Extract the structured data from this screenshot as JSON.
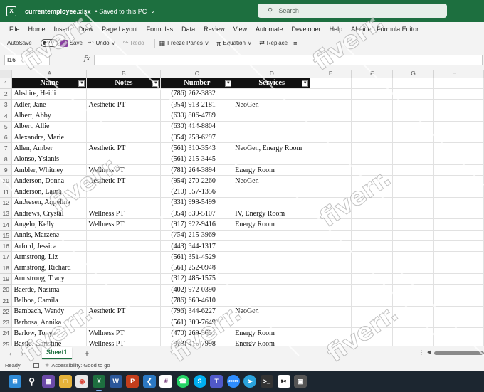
{
  "titlebar": {
    "filename": "currentemployee.xlsx",
    "saved_status": "• Saved to this PC",
    "search_placeholder": "Search",
    "accent_color": "#1d6f3f"
  },
  "menu": {
    "tabs": [
      "File",
      "Home",
      "Insert",
      "Draw",
      "Page Layout",
      "Formulas",
      "Data",
      "Review",
      "View",
      "Automate",
      "Developer",
      "Help",
      "AI-aided Formula Editor"
    ]
  },
  "toolbar": {
    "autosave_label": "AutoSave",
    "autosave_state": "Off",
    "save_label": "Save",
    "undo_label": "Undo",
    "redo_label": "Redo",
    "freeze_label": "Freeze Panes",
    "equation_label": "Equation",
    "replace_label": "Replace"
  },
  "formula_bar": {
    "name_box": "I16",
    "fx_label": "fx",
    "content": ""
  },
  "columns": [
    "A",
    "B",
    "C",
    "D",
    "E",
    "F",
    "G",
    "H"
  ],
  "header_row": {
    "row_number": "1",
    "cells": [
      "Name",
      "Notes",
      "Number",
      "Services"
    ]
  },
  "rows": [
    {
      "n": "2",
      "name": "Abshire, Heidi",
      "notes": "",
      "number": "(786) 262-3832",
      "services": ""
    },
    {
      "n": "3",
      "name": "Adler, Jane",
      "notes": "Aesthetic PT",
      "number": "(954) 913-2181",
      "services": "NeoGen"
    },
    {
      "n": "4",
      "name": "Albert, Abby",
      "notes": "",
      "number": "(630) 806-4789",
      "services": ""
    },
    {
      "n": "5",
      "name": "Albert, Allie",
      "notes": "",
      "number": "(630) 414-8804",
      "services": ""
    },
    {
      "n": "6",
      "name": "Alexandre, Marie",
      "notes": "",
      "number": "(954) 258-6297",
      "services": ""
    },
    {
      "n": "7",
      "name": "Allen, Amber",
      "notes": "Aesthetic PT",
      "number": "(561) 310-3543",
      "services": "NeoGen, Energy Room"
    },
    {
      "n": "8",
      "name": "Alonso, Yslanis",
      "notes": "",
      "number": "(561) 215-3445",
      "services": ""
    },
    {
      "n": "9",
      "name": "Ambler, Whitney",
      "notes": "Wellness PT",
      "number": "(781) 264-3894",
      "services": "Energy Room"
    },
    {
      "n": "10",
      "name": "Anderson, Donna",
      "notes": "Aesthetic PT",
      "number": "(954) 270-2260",
      "services": "NeoGen"
    },
    {
      "n": "11",
      "name": "Anderson, Laura",
      "notes": "",
      "number": "(210) 557-1356",
      "services": ""
    },
    {
      "n": "12",
      "name": "Andresen, Angelina",
      "notes": "",
      "number": "(331) 998-5499",
      "services": ""
    },
    {
      "n": "13",
      "name": "Andrews, Crystal",
      "notes": "Wellness PT",
      "number": "(954) 839-5107",
      "services": "IV, Energy Room"
    },
    {
      "n": "14",
      "name": "Angelo, Kelly",
      "notes": "Wellness PT",
      "number": "(917) 922-9416",
      "services": "Energy Room"
    },
    {
      "n": "15",
      "name": "Annis, Marzena",
      "notes": "",
      "number": "(754) 215-3969",
      "services": ""
    },
    {
      "n": "16",
      "name": "Arford, Jessica",
      "notes": "",
      "number": "(443) 944-1317",
      "services": ""
    },
    {
      "n": "17",
      "name": "Armstrong, Liz",
      "notes": "",
      "number": "(561) 351-4529",
      "services": ""
    },
    {
      "n": "18",
      "name": "Armstrong, Richard",
      "notes": "",
      "number": "(561) 252-0948",
      "services": ""
    },
    {
      "n": "19",
      "name": "Armstrong, Tracy",
      "notes": "",
      "number": "(312) 485-1575",
      "services": ""
    },
    {
      "n": "20",
      "name": "Baerde, Nasima",
      "notes": "",
      "number": "(402) 972-0390",
      "services": ""
    },
    {
      "n": "21",
      "name": "Balboa, Camila",
      "notes": "",
      "number": "(786) 660-4610",
      "services": ""
    },
    {
      "n": "22",
      "name": "Bambach, Wendy",
      "notes": "Aesthetic PT",
      "number": "(796) 344-6227",
      "services": "NeoGen"
    },
    {
      "n": "23",
      "name": "Barbosa, Annika",
      "notes": "",
      "number": "(561) 309-7649",
      "services": ""
    },
    {
      "n": "24",
      "name": "Barlow, Tonya",
      "notes": "Wellness PT",
      "number": "(470) 269-5651",
      "services": "Energy Room"
    },
    {
      "n": "25",
      "name": "Basile, Christine",
      "notes": "Wellness PT",
      "number": "(973) 415-7998",
      "services": "Energy Room"
    }
  ],
  "sheets": {
    "active": "Sheet1",
    "add_label": "+"
  },
  "statusbar": {
    "ready": "Ready",
    "accessibility": "Accessibility: Good to go"
  },
  "taskbar": {
    "apps": [
      "windows-start",
      "search",
      "widgets",
      "file-explorer",
      "chrome",
      "excel",
      "word",
      "powerpoint",
      "visual-studio-code",
      "slack",
      "whatsapp",
      "skype",
      "teams",
      "zoom",
      "telegram",
      "terminal",
      "capcut",
      "photos"
    ]
  },
  "watermark": "fiverr."
}
